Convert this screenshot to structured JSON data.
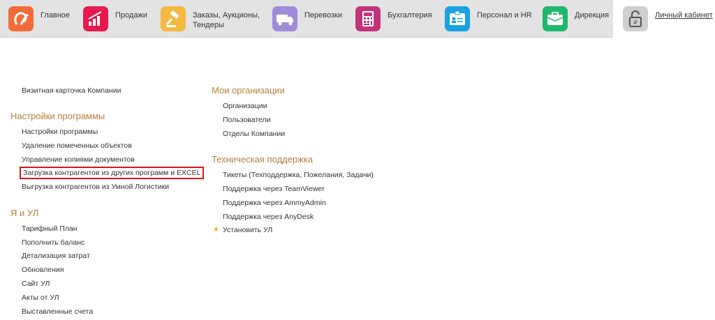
{
  "topnav": {
    "items": [
      {
        "label": "Главное",
        "icon": "logo-icon",
        "color": "#f26b3a"
      },
      {
        "label": "Продажи",
        "icon": "sales-chart-icon",
        "color": "#e8194f"
      },
      {
        "label": "Заказы,  Аукционы,",
        "label2": "Тендеры",
        "icon": "gavel-icon",
        "color": "#f5b942"
      },
      {
        "label": "Перевозки",
        "icon": "truck-icon",
        "color": "#a08bd8"
      },
      {
        "label": "Бухгалтерия",
        "icon": "calculator-icon",
        "color": "#c0337a"
      },
      {
        "label": "Персонал и HR",
        "icon": "id-card-icon",
        "color": "#1aa3e0"
      },
      {
        "label": "Дирекция",
        "icon": "briefcase-icon",
        "color": "#1fb86a"
      },
      {
        "label": "Личный кабинет",
        "icon": "unlock-icon",
        "color": "#cfcfcf"
      }
    ]
  },
  "left": {
    "company_card": "Визитная карточка Компании",
    "settings_title": "Настройки программы",
    "settings_links": [
      "Настройки программы",
      "Удаление помеченных объектов",
      "Управление копиями документов",
      "Загрузка контрагентов из других программ и EXCEL",
      "Выгрузка контрагентов из Умной Логистики"
    ],
    "me_title": "Я и УЛ",
    "me_links": [
      "Тарифный План",
      "Пополнить баланс",
      "Детализация затрат",
      "Обновления",
      "Сайт УЛ",
      "Акты от УЛ",
      "Выставленные счета"
    ]
  },
  "right": {
    "orgs_title": "Мои организации",
    "orgs_links": [
      "Организации",
      "Пользователи",
      "Отделы Компании"
    ],
    "support_title": "Техническая поддержка",
    "support_links": [
      "Тикеты (Техподдержка, Пожелания, Задачи)",
      "Поддержка через TeamViewer",
      "Поддержка через AmmyAdmin",
      "Поддержка через AnyDesk",
      "Установить УЛ"
    ]
  },
  "colors": {
    "section_title": "#b47f3a",
    "highlight": "#d9141b",
    "star": "#f0b429"
  }
}
